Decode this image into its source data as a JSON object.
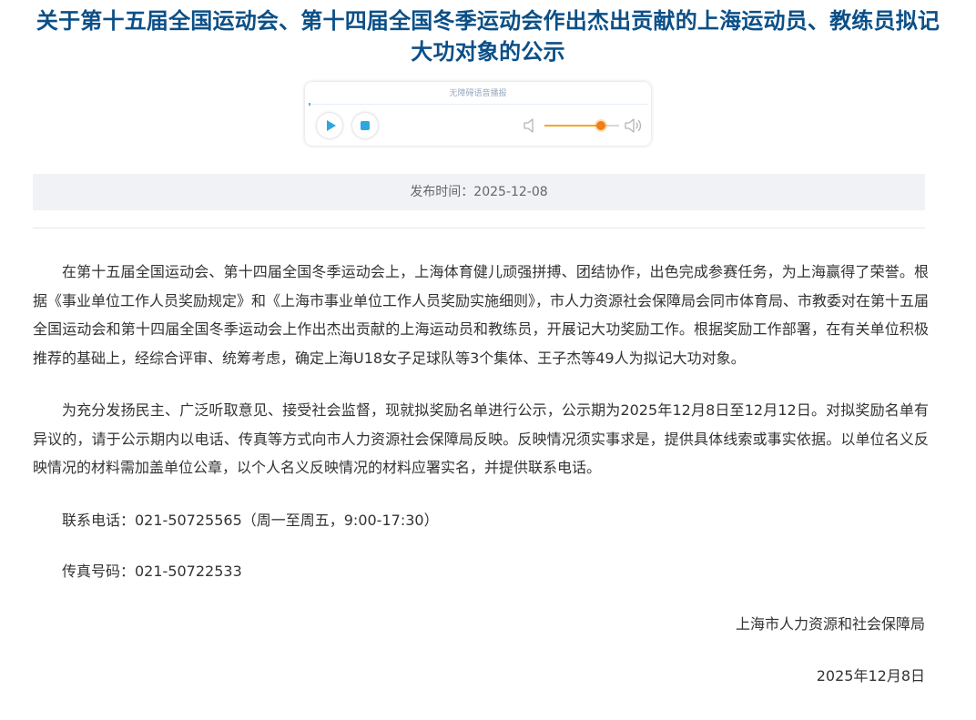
{
  "article": {
    "title": "关于第十五届全国运动会、第十四届全国冬季运动会作出杰出贡献的上海运动员、教练员拟记大功对象的公示",
    "publish_label": "发布时间：",
    "publish_date": "2025-12-08",
    "publish_text": "发布时间：2025-12-08",
    "paragraphs": [
      "在第十五届全国运动会、第十四届全国冬季运动会上，上海体育健儿顽强拼搏、团结协作，出色完成参赛任务，为上海赢得了荣誉。根据《事业单位工作人员奖励规定》和《上海市事业单位工作人员奖励实施细则》，市人力资源社会保障局会同市体育局、市教委对在第十五届全国运动会和第十四届全国冬季运动会上作出杰出贡献的上海运动员和教练员，开展记大功奖励工作。根据奖励工作部署，在有关单位积极推荐的基础上，经综合评审、统筹考虑，确定上海U18女子足球队等3个集体、王子杰等49人为拟记大功对象。",
      "为充分发扬民主、广泛听取意见、接受社会监督，现就拟奖励名单进行公示，公示期为2025年12月8日至12月12日。对拟奖励名单有异议的，请于公示期内以电话、传真等方式向市人力资源社会保障局反映。反映情况须实事求是，提供具体线索或事实依据。以单位名义反映情况的材料需加盖单位公章，以个人名义反映情况的材料应署实名，并提供联系电话。",
      "联系电话：021-50725565（周一至周五，9:00-17:30）",
      "传真号码：021-50722533"
    ],
    "signature_org": "上海市人力资源和社会保障局",
    "signature_date": "2025年12月8日"
  },
  "audio_player": {
    "label": "无障碍语音播报",
    "progress": 0,
    "volume": 0.75,
    "accent_color": "#2ea7e0",
    "volume_color": "#f5a623",
    "icons": {
      "play": "play-icon",
      "stop": "stop-icon",
      "volume_low": "volume-low-icon",
      "volume_high": "volume-high-icon"
    }
  },
  "colors": {
    "title": "#0b4f87",
    "date_bar_bg": "#f0f2f5",
    "body_text": "#333333"
  }
}
